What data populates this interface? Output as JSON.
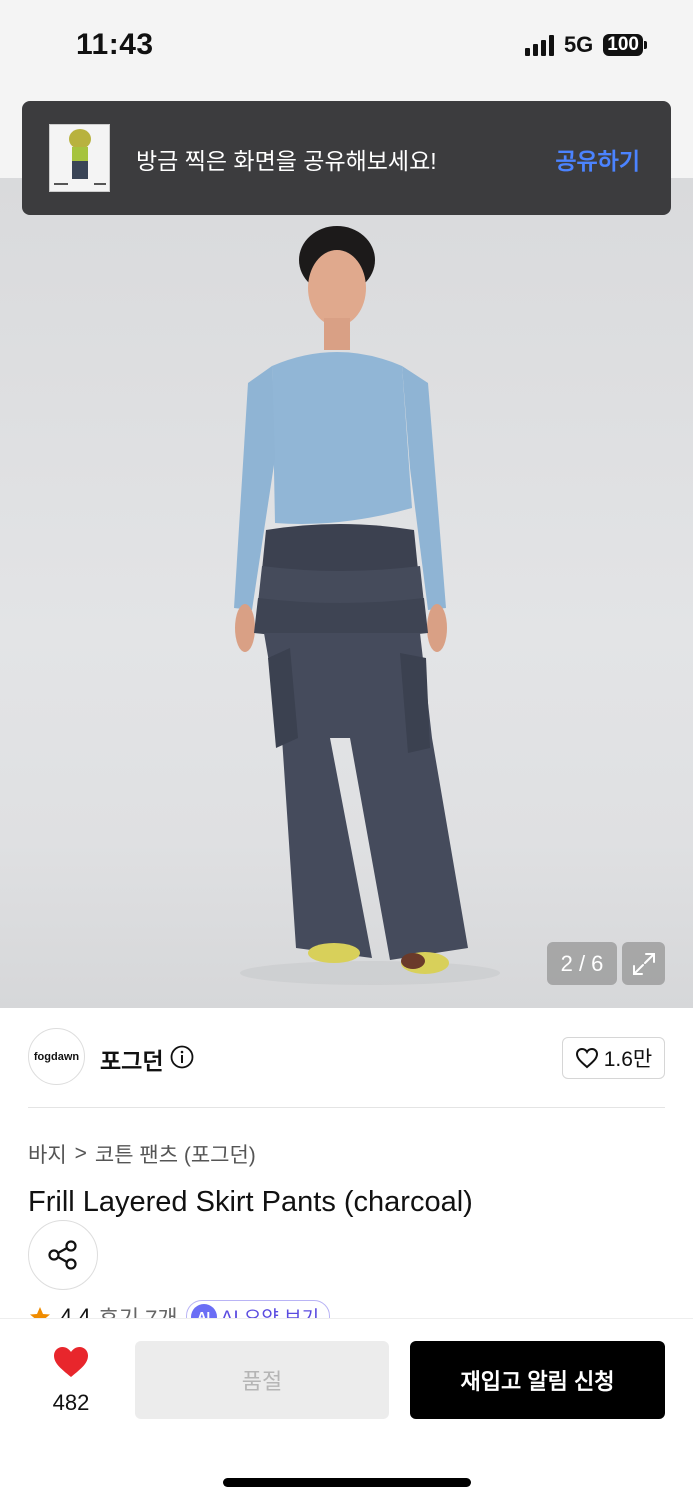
{
  "status_bar": {
    "time": "11:43",
    "network": "5G",
    "battery": "100"
  },
  "toast": {
    "message": "방금 찍은 화면을 공유해보세요!",
    "action": "공유하기"
  },
  "gallery": {
    "counter": "2 / 6"
  },
  "brand": {
    "logo_text": "fogdawn",
    "name": "포그던",
    "likes": "1.6만"
  },
  "breadcrumb": {
    "category": "바지",
    "separator": ">",
    "subcategory": "코튼 팬츠 (포그던)"
  },
  "product": {
    "title": "Frill Layered Skirt Pants (charcoal)"
  },
  "rating": {
    "score": "4.4",
    "reviews": "후기 7개",
    "ai_label": "AI",
    "ai_summary": "AI 요약 보기"
  },
  "bottom_bar": {
    "wish_count": "482",
    "soldout_label": "품절",
    "restock_label": "재입고 알림 신청"
  },
  "colors": {
    "accent_link": "#4b83ff",
    "heart": "#e8262c",
    "star": "#f08c00"
  }
}
